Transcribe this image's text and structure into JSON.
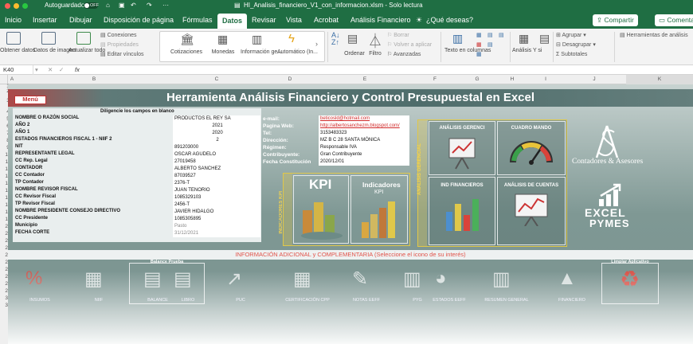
{
  "window": {
    "autosave_label": "Autoguardado",
    "autosave_state": "OFF",
    "title": "HI_Analisis_financiero_V1_con_informacion.xlsm - Solo lectura"
  },
  "menu": {
    "tabs": [
      "Inicio",
      "Insertar",
      "Dibujar",
      "Disposición de página",
      "Fórmulas",
      "Datos",
      "Revisar",
      "Vista",
      "Acrobat",
      "Análisis Financiero"
    ],
    "selected": "Datos",
    "help": "¿Qué deseas?",
    "share": "Compartir",
    "comments": "Comentar"
  },
  "ribbon": {
    "obtener": "Obtener datos",
    "datos_imagen": "Datos de imagen",
    "actualizar": "Actualizar todo",
    "conexiones": "Conexiones",
    "propiedades": "Propiedades",
    "editar_vinculos": "Editar vínculos",
    "types": [
      "Cotizaciones",
      "Monedas",
      "Información ge...",
      "Automático (In..."
    ],
    "ordenar": "Ordenar",
    "filtro": "Filtro",
    "borrar": "Borrar",
    "volver_aplicar": "Volver a aplicar",
    "avanzadas": "Avanzadas",
    "texto_columnas": "Texto en columnas",
    "analisis_si": "Análisis Y si",
    "agrupar": "Agrupar",
    "desagrupar": "Desagrupar",
    "subtotales": "Subtotales",
    "herramientas": "Herramientas de análisis"
  },
  "formula_bar": {
    "cell": "K40",
    "fx": "fx",
    "value": ""
  },
  "columns": [
    "A",
    "B",
    "C",
    "D",
    "E",
    "F",
    "G",
    "H",
    "I",
    "J",
    "K"
  ],
  "rows": [
    "1",
    "2",
    "3",
    "4",
    "5",
    "6",
    "7",
    "8",
    "9",
    "10",
    "11",
    "12",
    "13",
    "14",
    "15",
    "16",
    "17",
    "18",
    "19",
    "20",
    "21",
    "22",
    "23",
    "24",
    "25",
    "26",
    "27",
    "28",
    "29",
    "30",
    "31"
  ],
  "sheet": {
    "menu_button": "Menú",
    "title": "Herramienta Análisis Financiero y Control Presupuestal en Excel",
    "diligencie": "Diligencie los campos en blanco",
    "form": [
      {
        "label": "NOMBRE O RAZÓN SOCIAL",
        "value": "PRODUCTOS EL REY SA",
        "align": "left"
      },
      {
        "label": "AÑO 2",
        "value": "2021",
        "align": "center"
      },
      {
        "label": "AÑO 1",
        "value": "2020",
        "align": "center"
      },
      {
        "label": "ESTADOS FINANCIEROS FISCAL 1 - NIIF 2",
        "value": "2",
        "align": "center"
      },
      {
        "label": "NIT",
        "value": "891203000",
        "align": "left"
      },
      {
        "label": "REPRESENTANTE LEGAL",
        "value": "OSCAR AGUDELO",
        "align": "left"
      },
      {
        "label": "CC Rep. Legal",
        "value": "27019458",
        "align": "left"
      },
      {
        "label": "CONTADOR",
        "value": "ALBERTO SANCHEZ",
        "align": "left"
      },
      {
        "label": "CC Contador",
        "value": "87039527",
        "align": "left"
      },
      {
        "label": "TP Contador",
        "value": "2376-T",
        "align": "left"
      },
      {
        "label": "NOMBRE REVISOR FISCAL",
        "value": "JUAN TENORIO",
        "align": "left"
      },
      {
        "label": "CC Revisor Fiscal",
        "value": "1085329103",
        "align": "left"
      },
      {
        "label": "TP Revisor Fiscal",
        "value": "2456-T",
        "align": "left"
      },
      {
        "label": "NOMBRE PRESIDENTE CONSEJO DIRECTIVO",
        "value": "JAVIER HIDALGO",
        "align": "left"
      },
      {
        "label": "CC Presidente",
        "value": "1085305895",
        "align": "left"
      },
      {
        "label": "Municipio",
        "value": "Pasto",
        "align": "left"
      },
      {
        "label": "FECHA CORTE",
        "value": "31/12/2021",
        "align": "left"
      }
    ],
    "contact": [
      {
        "label": "e-mail:",
        "value": "beticosld@hotmail.com",
        "link": true
      },
      {
        "label": "Pagina Web:",
        "value": "http://albertosanchezm.blogspot.com/",
        "link": true
      },
      {
        "label": "Tel:",
        "value": "3153483323",
        "link": false
      },
      {
        "label": "Dirección:",
        "value": "MZ B C 28 SANTA MÓNICA",
        "link": false
      },
      {
        "label": "Régimen:",
        "value": "Responsable IVA",
        "link": false
      },
      {
        "label": "Contribuyente:",
        "value": "Gran Contribuyente",
        "link": false
      },
      {
        "label": "Fecha Constitución",
        "value": "2020/12/01",
        "link": false
      }
    ],
    "indicadores_kpi_vertical": "INDICADORES KPI",
    "kpi_big": "KPI",
    "indicadores_label": "Indicadores",
    "indicadores_kpi": "KPI",
    "analisis_gerencial_vertical": "ANÁLISIS GERENCIAL",
    "tiles": [
      "ANÁLISIS GERENCI",
      "CUADRO MANDO",
      "IND FINANCIEROS",
      "ANÁLISIS DE CUENTAS"
    ],
    "logo_name": "Contadores & Asesores",
    "excel_pymes": [
      "EXCEL",
      "PYMES"
    ],
    "info_text": "INFORMACIÓN ADICIONAL y COMPLEMENTARIA (Seleccione el icono de su interés)",
    "bottom_group_title": "Balance Prueba",
    "bottom_group_right": "Limpiar Aplicativo",
    "bottom_labels": [
      "INSUMOS",
      "NIIF",
      "BALANCE",
      "LIBRO",
      "PUC",
      "CERTIFICACIÓN CPP",
      "NOTAS EEFF",
      "PYG",
      "ESTADOS EEFF",
      "RESUMEN GENERAL",
      "FINANCIERO"
    ]
  },
  "colors": {
    "excel_green": "#1f6e43",
    "accent_red": "#c23030",
    "panel_border": "#e0c84a"
  }
}
